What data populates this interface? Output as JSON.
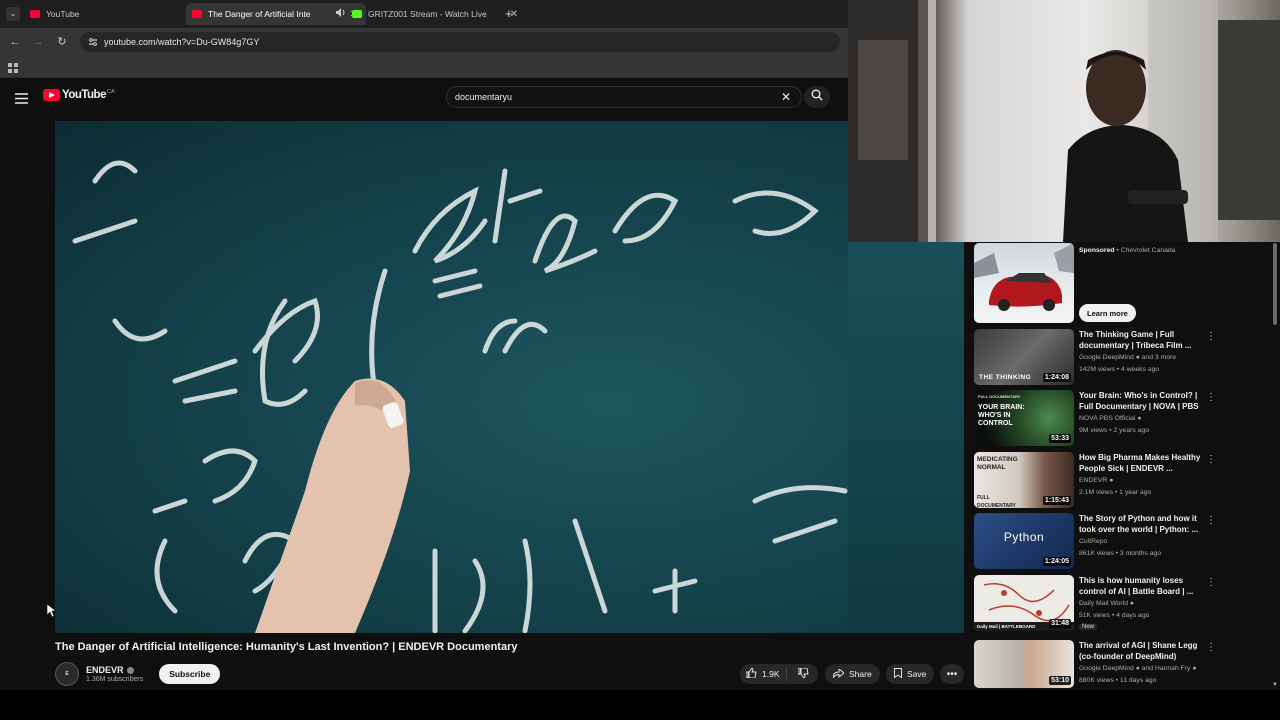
{
  "browser": {
    "tabs": [
      {
        "title": "YouTube",
        "favicon_color": "#ff0033",
        "active": false
      },
      {
        "title": "The Danger of Artificial Inte",
        "favicon_color": "#ff0033",
        "active": true
      },
      {
        "title": "GRITZ001 Stream - Watch Live",
        "favicon_color": "#53fc18",
        "active": false
      }
    ],
    "url": "youtube.com/watch?v=Du-GW84g7GY"
  },
  "youtube": {
    "logo_text": "YouTube",
    "country_code": "CA",
    "search_value": "documentaryu"
  },
  "video": {
    "title": "The Danger of Artificial Intelligence: Humanity's Last Invention? | ENDEVR Documentary",
    "channel": "ENDEVR",
    "subscribers": "1.36M subscribers",
    "subscribe_label": "Subscribe",
    "likes": "1.9K",
    "share_label": "Share",
    "save_label": "Save"
  },
  "ad": {
    "sponsored": "Sponsored",
    "advertiser": "Chevrolet Canada",
    "cta": "Learn more"
  },
  "recommendations": [
    {
      "title": "The Thinking Game | Full documentary | Tribeca Film ...",
      "channel": "Google DeepMind",
      "channel_extra": "and 3 more",
      "meta": "142M views • 4 weeks ago",
      "duration": "1:24:08"
    },
    {
      "title": "Your Brain: Who's in Control? | Full Documentary | NOVA | PBS",
      "channel": "NOVA PBS Official",
      "channel_extra": "",
      "meta": "9M views • 2 years ago",
      "duration": "53:33"
    },
    {
      "title": "How Big Pharma Makes Healthy People Sick | ENDEVR ...",
      "channel": "ENDEVR",
      "channel_extra": "",
      "meta": "2.1M views • 1 year ago",
      "duration": "1:15:43"
    },
    {
      "title": "The Story of Python and how it took over the world | Python: ...",
      "channel": "CultRepo",
      "channel_extra": "",
      "meta": "861K views • 3 months ago",
      "duration": "1:24:05"
    },
    {
      "title": "This is how humanity loses control of AI | Battle Board | ...",
      "channel": "Daily Mail World",
      "channel_extra": "",
      "meta": "51K views • 4 days ago",
      "duration": "31:48",
      "badge": "New"
    },
    {
      "title": "The arrival of AGI | Shane Legg (co-founder of DeepMind)",
      "channel": "Google DeepMind",
      "channel_extra": "and Hannah Fry",
      "meta": "880K views • 11 days ago",
      "duration": "53:10"
    }
  ],
  "thumb_text": {
    "thinking": "THE THINKING",
    "brain_label": "FULL DOCUMENTARY",
    "brain_title": "YOUR BRAIN: WHO'S IN CONTROL",
    "pharma": "MEDICATING NORMAL",
    "pharma_sub": "FULL DOCUMENTARY",
    "python": "Python",
    "battle": "Daily Mail | BATTLEBOARD"
  },
  "colors": {
    "accent_red": "#ff0033",
    "chalkboard": "#174852"
  }
}
